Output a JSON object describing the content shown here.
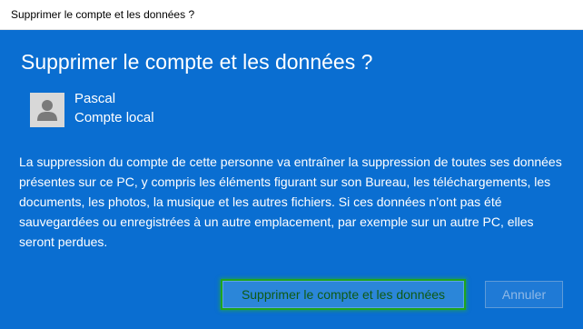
{
  "window": {
    "title": "Supprimer le compte et les données ?"
  },
  "dialog": {
    "heading": "Supprimer le compte et les données ?",
    "user": {
      "name": "Pascal",
      "type": "Compte local",
      "avatar_icon": "user-silhouette-icon"
    },
    "message": "La suppression du compte de cette personne va entraîner la suppression de toutes ses données présentes sur ce PC, y compris les éléments figurant sur son Bureau, les téléchargements, les documents, les photos, la musique et les autres fichiers. Si ces données n’ont pas été sauvegardées ou enregistrées à un autre emplacement, par exemple sur un autre PC, elles seront perdues.",
    "buttons": {
      "delete_label": "Supprimer le compte et les données",
      "cancel_label": "Annuler"
    }
  },
  "colors": {
    "dialog_background": "#0a6ed1",
    "highlight": "#1ea41e"
  }
}
